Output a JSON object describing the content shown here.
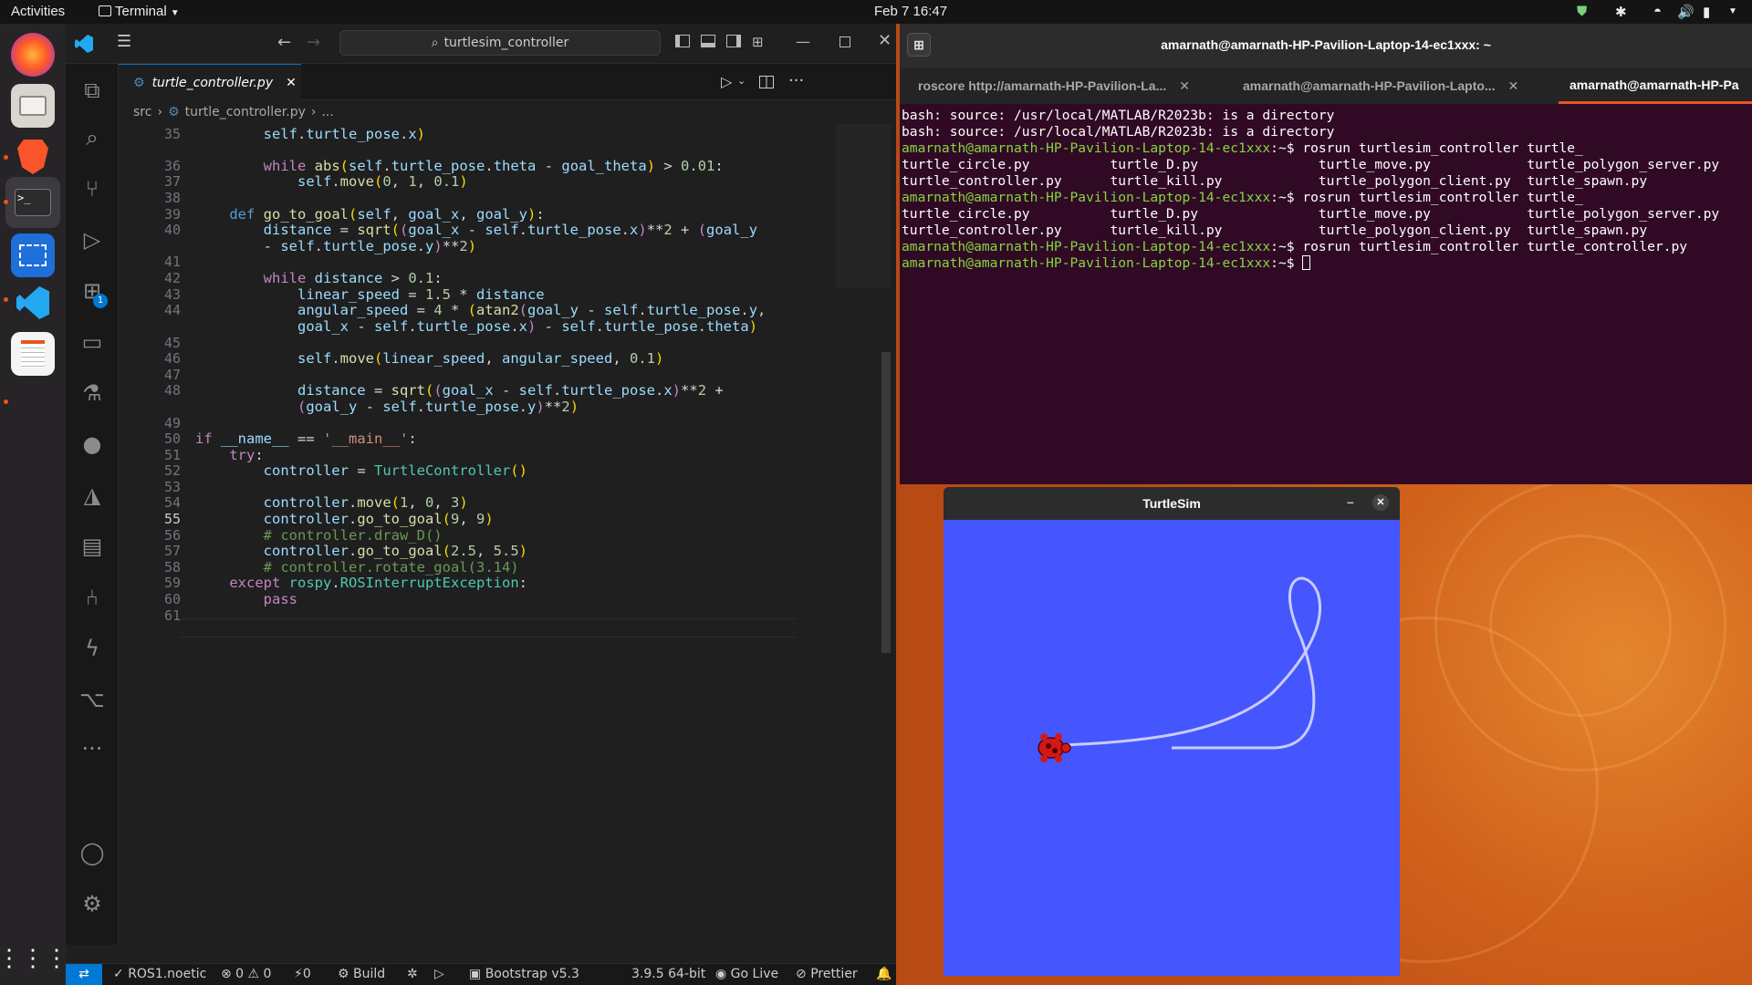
{
  "topbar": {
    "activities": "Activities",
    "app_name": "Terminal",
    "clock": "Feb 7  16:47"
  },
  "colors": {
    "vscode_accent": "#0078d4",
    "terminal_bg": "#300a24",
    "prompt_green": "#87d441",
    "turtlesim_bg": "#4556ff",
    "ubuntu_orange": "#e95420"
  },
  "vscode": {
    "search_box": "turtlesim_controller",
    "tab_label": "turtle_controller.py",
    "breadcrumb": {
      "folder": "src",
      "file": "turtle_controller.py",
      "more": "..."
    },
    "activity_badge": "1",
    "line_numbers": [
      "35",
      "36",
      "37",
      "38",
      "39",
      "40",
      "",
      "41",
      "42",
      "43",
      "44",
      "",
      "45",
      "46",
      "47",
      "48",
      "",
      "49",
      "50",
      "51",
      "52",
      "53",
      "54",
      "55",
      "56",
      "57",
      "58",
      "59",
      "60",
      "61"
    ],
    "status": {
      "branch": "ROS1.noetic",
      "problems": "⊗ 0 ⚠ 0",
      "ports": "⚡0",
      "build": "Build",
      "bootstrap": "Bootstrap v5.3",
      "python": "3.9.5 64-bit",
      "go_live": "Go Live",
      "prettier": "Prettier"
    }
  },
  "terminal": {
    "title": "amarnath@amarnath-HP-Pavilion-Laptop-14-ec1xxx: ~",
    "tabs": [
      "roscore http://amarnath-HP-Pavilion-La...",
      "amarnath@amarnath-HP-Pavilion-Lapto...",
      "amarnath@amarnath-HP-Pa"
    ],
    "lines": [
      "bash: source: /usr/local/MATLAB/R2023b: is a directory",
      "bash: source: /usr/local/MATLAB/R2023b: is a directory",
      "turtle_circle.py          turtle_D.py               turtle_move.py            turtle_polygon_server.py",
      "turtle_controller.py      turtle_kill.py            turtle_polygon_client.py  turtle_spawn.py",
      "turtle_circle.py          turtle_D.py               turtle_move.py            turtle_polygon_server.py",
      "turtle_controller.py      turtle_kill.py            turtle_polygon_client.py  turtle_spawn.py"
    ],
    "prompt": "amarnath@amarnath-HP-Pavilion-Laptop-14-ec1xxx",
    "prompt_suffix": ":~$ ",
    "cmd1": "rosrun turtlesim_controller turtle_",
    "cmd2": "rosrun turtlesim_controller turtle_",
    "cmd3": "rosrun turtlesim_controller turtle_controller.py"
  },
  "turtlesim": {
    "title": "TurtleSim"
  }
}
